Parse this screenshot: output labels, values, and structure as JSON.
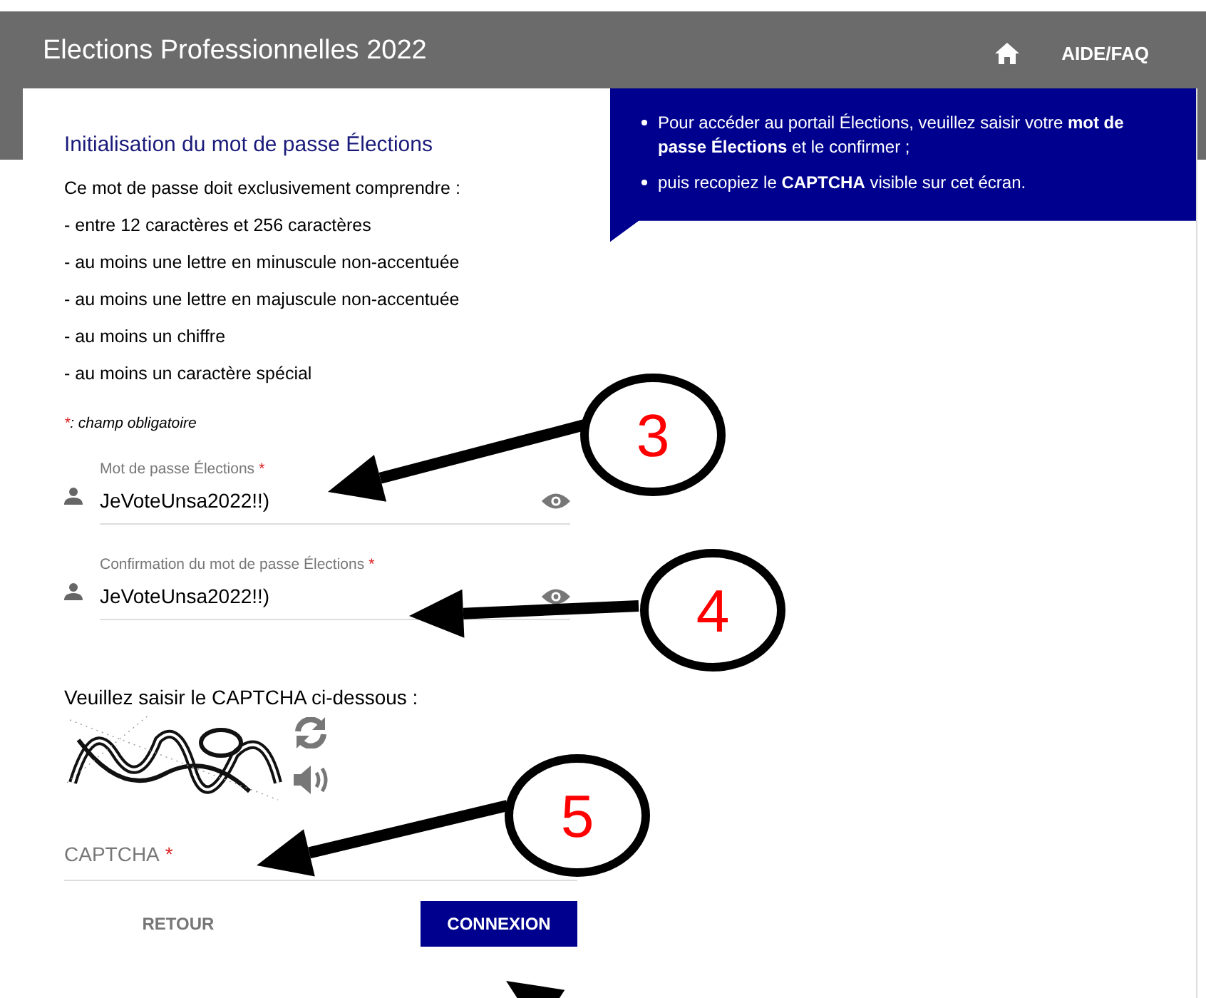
{
  "header": {
    "title": "Elections Professionnelles 2022",
    "links": [
      {
        "kind": "home"
      },
      {
        "kind": "text",
        "label": "AIDE/FAQ"
      }
    ]
  },
  "info_panel": {
    "items": [
      "Pour accéder au portail Élections, veuillez saisir votre **mot de passe Élections** et le confirmer ;",
      "puis recopiez le **CAPTCHA** visible sur cet écran."
    ]
  },
  "form": {
    "title": "Initialisation du mot de passe Élections",
    "intro": "Ce mot de passe doit exclusivement comprendre :",
    "rules": [
      "- entre 12 caractères et 256 caractères",
      "- au moins une lettre en minuscule non-accentuée",
      "- au moins une lettre en majuscule non-accentuée",
      "- au moins un chiffre",
      "- au moins un caractère spécial"
    ],
    "required_mark": "*",
    "required_note": ": champ obligatoire",
    "fields": [
      {
        "label": "Mot de passe Élections",
        "value": "JeVoteUnsa2022!!)"
      },
      {
        "label": "Confirmation du mot de passe Élections",
        "value": "JeVoteUnsa2022!!)"
      }
    ],
    "captcha_heading": "Veuillez saisir le CAPTCHA ci-dessous :",
    "captcha_field": {
      "placeholder": "CAPTCHA"
    },
    "buttons": [
      {
        "kind": "text",
        "label": "RETOUR"
      },
      {
        "kind": "primary",
        "label": "CONNEXION"
      }
    ]
  },
  "annotations": [
    {
      "label": "3"
    },
    {
      "label": "4"
    },
    {
      "label": "5"
    }
  ]
}
